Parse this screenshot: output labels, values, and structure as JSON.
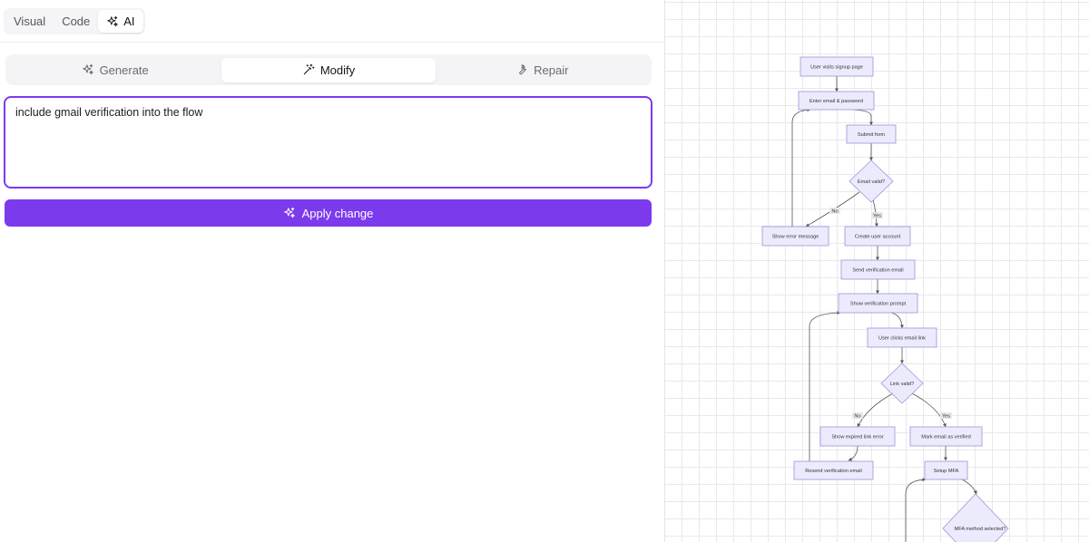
{
  "mode_tabs": [
    {
      "label": "Visual"
    },
    {
      "label": "Code"
    },
    {
      "label": "AI"
    }
  ],
  "ai_tabs": [
    {
      "label": "Generate"
    },
    {
      "label": "Modify"
    },
    {
      "label": "Repair"
    }
  ],
  "prompt": {
    "value": "include gmail verification into the flow"
  },
  "apply_button": {
    "label": "Apply change"
  },
  "colors": {
    "accent": "#7c3aed",
    "node_fill": "#ecebfd",
    "node_stroke": "#9b95d6",
    "edge": "#555555"
  },
  "flow": {
    "nodes": {
      "visits": "User visits signup page",
      "enter": "Enter email & password",
      "submit": "Submit form",
      "email_valid": "Email valid?",
      "error": "Show error message",
      "create": "Create user account",
      "send": "Send verification email",
      "prompt": "Show verification prompt",
      "clicks": "User clicks email link",
      "link_valid": "Link valid?",
      "expired": "Show expired link error",
      "mark": "Mark email as verified",
      "resend": "Resend verification email",
      "mfa": "Setup MFA",
      "mfa_method": "MFA method selected?"
    },
    "edge_labels": {
      "no": "No",
      "yes": "Yes"
    }
  }
}
